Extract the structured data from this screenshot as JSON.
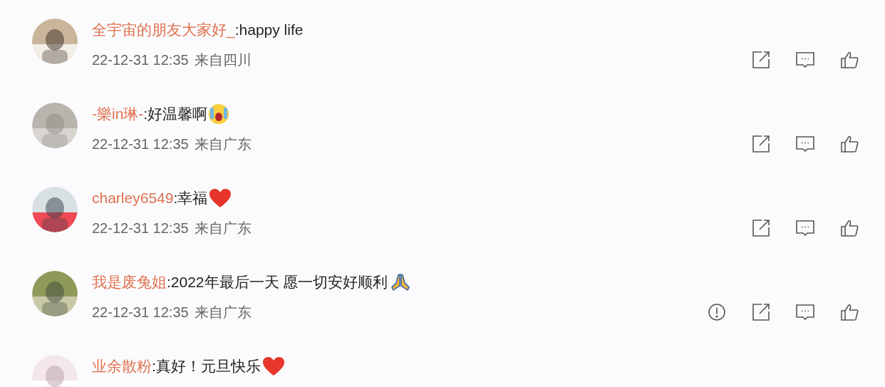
{
  "comments": [
    {
      "user": "全宇宙的朋友大家好_",
      "text": ":happy life",
      "time": "22-12-31 12:35",
      "location": "来自四川",
      "report": false
    },
    {
      "user": "-樂in琳-",
      "text": ":好温馨啊",
      "emoji": {
        "kind": "crying"
      },
      "time": "22-12-31 12:35",
      "location": "来自广东",
      "report": false
    },
    {
      "user": "charley6549",
      "text": ":幸福",
      "emoji": {
        "kind": "heart"
      },
      "time": "22-12-31 12:35",
      "location": "来自广东",
      "report": false
    },
    {
      "user": "我是废兔姐",
      "text": ":2022年最后一天 愿一切安好顺利",
      "emoji": {
        "kind": "pray"
      },
      "time": "22-12-31 12:35",
      "location": "来自广东",
      "report": true
    },
    {
      "user": "业余散粉",
      "text": ":真好！元旦快乐",
      "emoji": {
        "kind": "heart"
      },
      "report": false
    }
  ]
}
